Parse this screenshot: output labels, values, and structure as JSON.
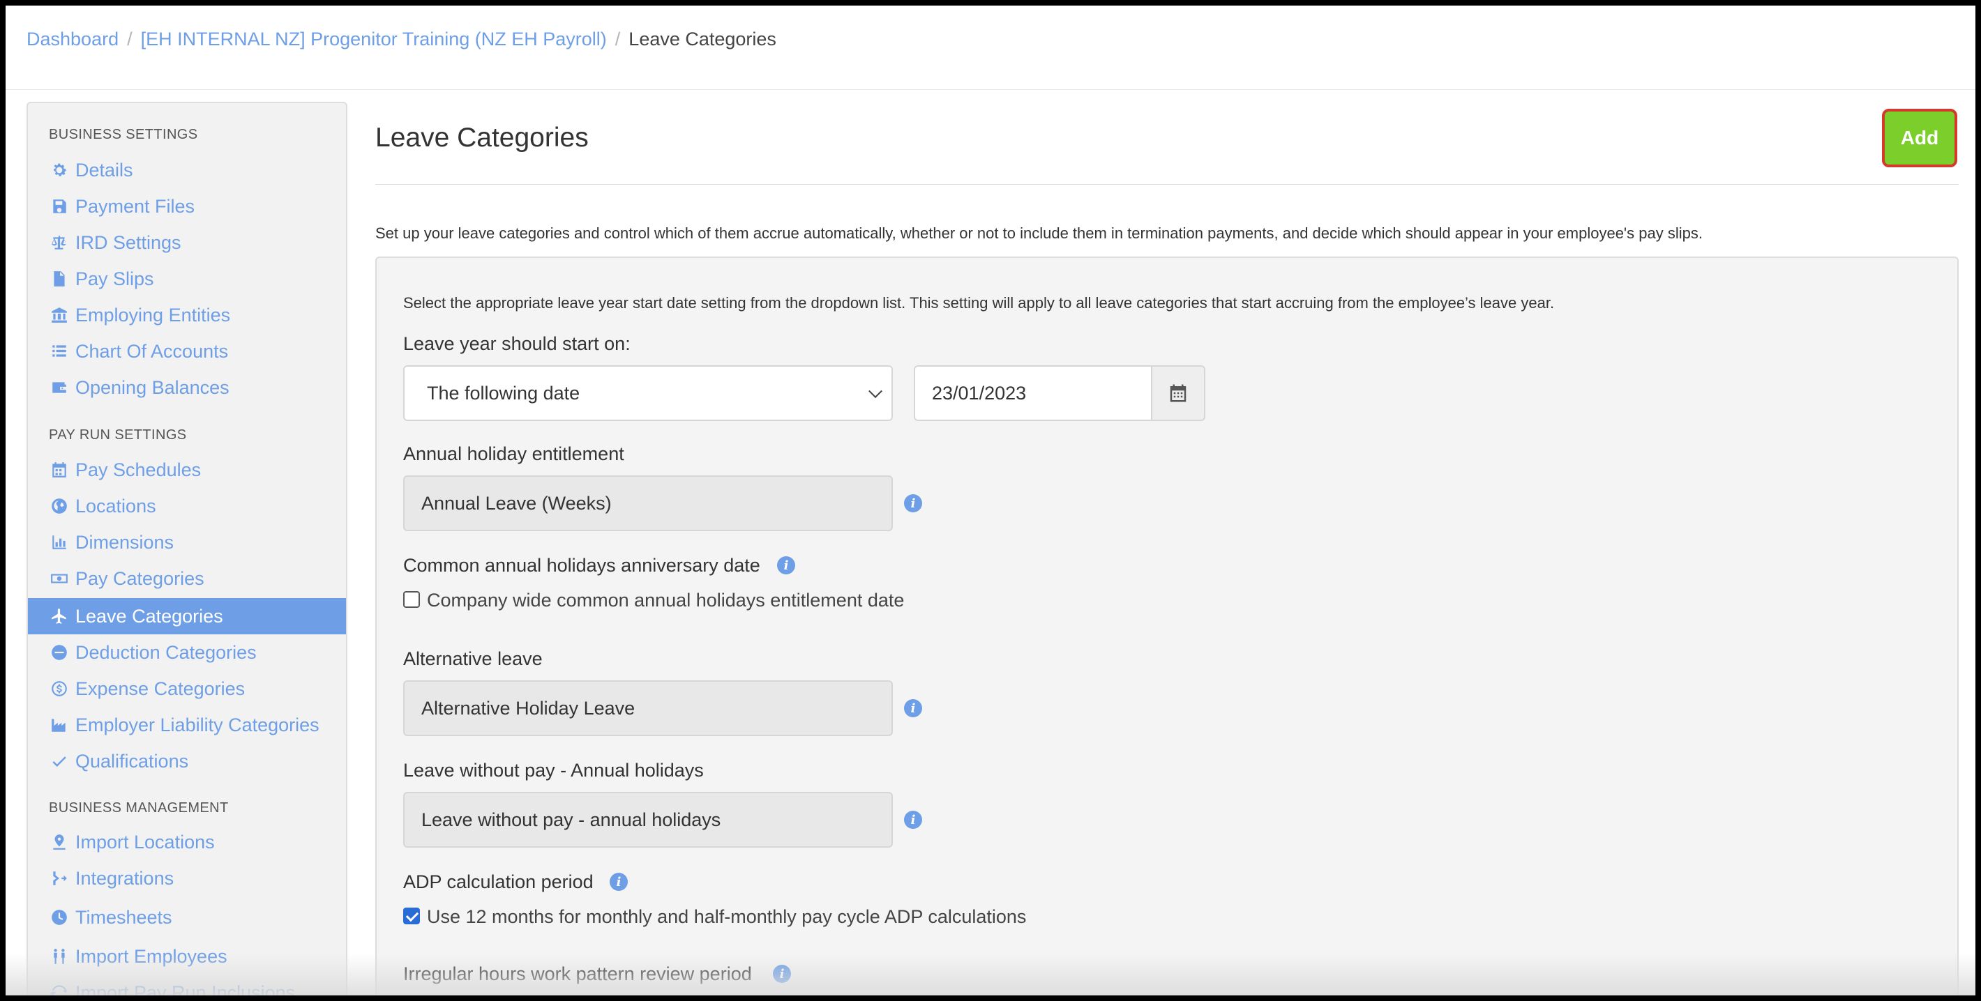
{
  "breadcrumb": {
    "items": [
      "Dashboard",
      "[EH INTERNAL NZ] Progenitor Training (NZ EH Payroll)",
      "Leave Categories"
    ],
    "separator": "/"
  },
  "sidebar": {
    "sections": [
      {
        "header": "BUSINESS SETTINGS",
        "items": [
          {
            "label": "Details",
            "icon": "gear-icon"
          },
          {
            "label": "Payment Files",
            "icon": "floppy-icon"
          },
          {
            "label": "IRD Settings",
            "icon": "scales-icon"
          },
          {
            "label": "Pay Slips",
            "icon": "file-icon"
          },
          {
            "label": "Employing Entities",
            "icon": "bank-icon"
          },
          {
            "label": "Chart Of Accounts",
            "icon": "list-icon"
          },
          {
            "label": "Opening Balances",
            "icon": "wallet-icon"
          }
        ]
      },
      {
        "header": "PAY RUN SETTINGS",
        "items": [
          {
            "label": "Pay Schedules",
            "icon": "calendar-icon"
          },
          {
            "label": "Locations",
            "icon": "globe-icon"
          },
          {
            "label": "Dimensions",
            "icon": "bar-chart-icon"
          },
          {
            "label": "Pay Categories",
            "icon": "money-icon"
          },
          {
            "label": "Leave Categories",
            "icon": "plane-icon",
            "active": true
          },
          {
            "label": "Deduction Categories",
            "icon": "minus-circle-icon"
          },
          {
            "label": "Expense Categories",
            "icon": "dollar-circle-icon"
          },
          {
            "label": "Employer Liability Categories",
            "icon": "industry-icon"
          },
          {
            "label": "Qualifications",
            "icon": "check-icon"
          }
        ]
      },
      {
        "header": "BUSINESS MANAGEMENT",
        "items": [
          {
            "label": "Import Locations",
            "icon": "map-pin-icon"
          },
          {
            "label": "Integrations",
            "icon": "integration-icon"
          },
          {
            "label": "Timesheets",
            "icon": "clock-icon"
          },
          {
            "label": "Import Employees",
            "icon": "users-icon"
          },
          {
            "label": "Import Pay Run Inclusions",
            "icon": "refresh-icon"
          }
        ]
      }
    ]
  },
  "main": {
    "title": "Leave Categories",
    "add_label": "Add",
    "intro": "Set up your leave categories and control which of them accrue automatically, whether or not to include them in termination payments, and decide which should appear in your employee's pay slips.",
    "panel": {
      "instruction": "Select the appropriate leave year start date setting from the dropdown list. This setting will apply to all leave categories that start accruing from the employee’s leave year.",
      "leave_year_label": "Leave year should start on:",
      "leave_year_select": "The following date",
      "leave_year_date": "23/01/2023",
      "annual_label": "Annual holiday entitlement",
      "annual_value": "Annual Leave (Weeks)",
      "common_label": "Common annual holidays anniversary date",
      "common_checkbox_label": "Company wide common annual holidays entitlement date",
      "common_checked": false,
      "alt_label": "Alternative leave",
      "alt_value": "Alternative Holiday Leave",
      "lwop_label": "Leave without pay - Annual holidays",
      "lwop_value": "Leave without pay - annual holidays",
      "adp_label": "ADP calculation period",
      "adp_checkbox_label": "Use 12 months for monthly and half-monthly pay cycle ADP calculations",
      "adp_checked": true,
      "irregular_label": "Irregular hours work pattern review period"
    }
  },
  "colors": {
    "link": "#6e9fe6",
    "active_bg": "#6e9fe6",
    "add_button": "#7ccf2a",
    "add_button_border": "#d23b2c"
  }
}
